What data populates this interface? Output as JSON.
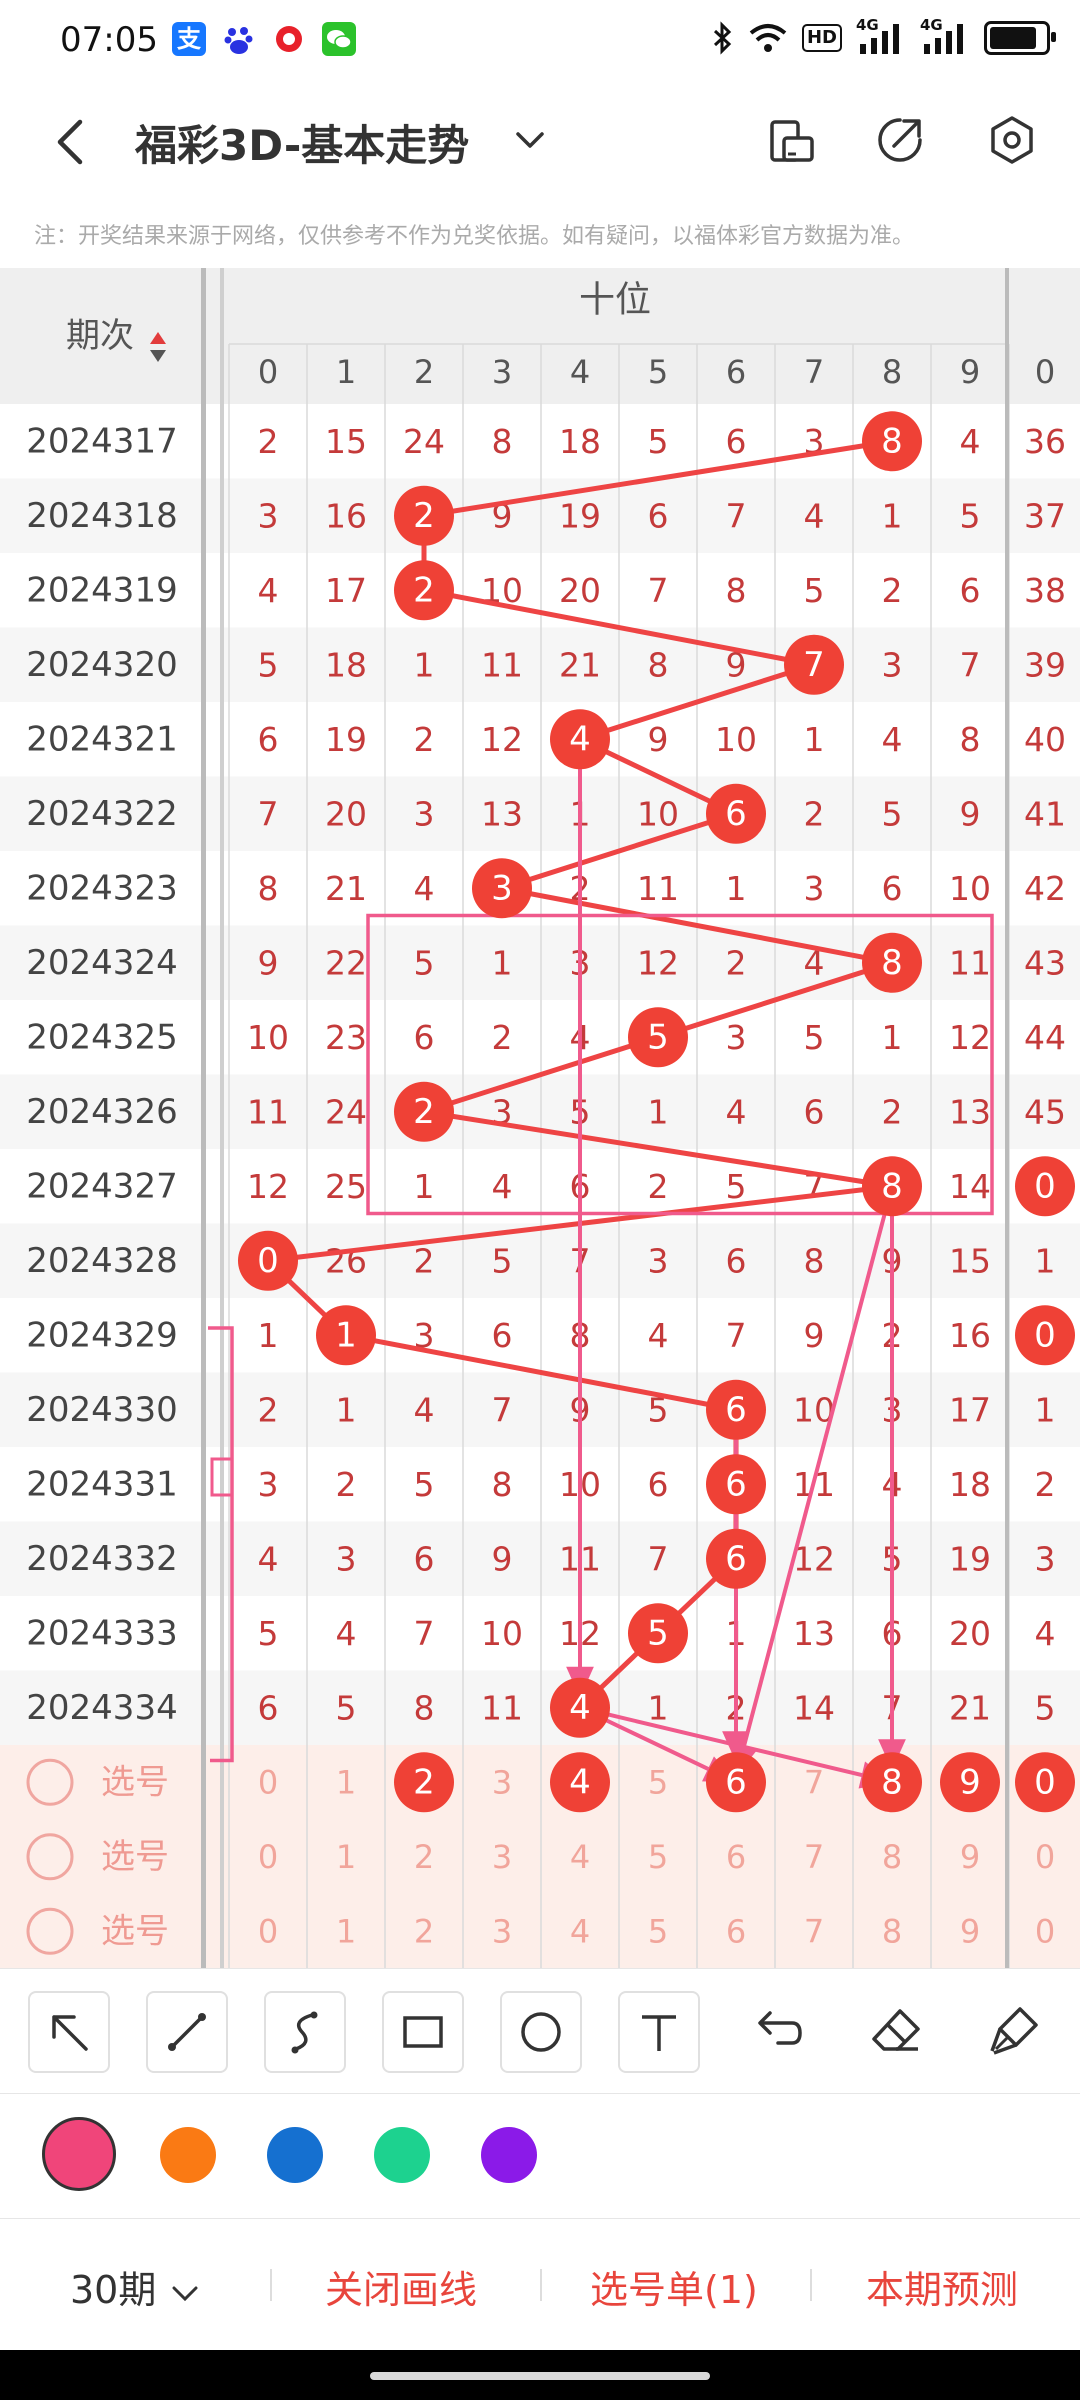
{
  "status_bar": {
    "time": "07:05",
    "app_icons": [
      "alipay-icon",
      "baidu-icon",
      "record-icon",
      "wechat-icon"
    ],
    "right_icons": [
      "bluetooth-icon",
      "wifi-icon",
      "hd-icon",
      "signal-4g-icon",
      "signal-4g-icon",
      "battery-icon"
    ],
    "hd_label": "HD",
    "net_label": "4G"
  },
  "header": {
    "title": "福彩3D-基本走势",
    "icons": [
      "back-icon",
      "chevron-down-icon",
      "device-icon",
      "share-icon",
      "settings-icon"
    ]
  },
  "notice": "注：开奖结果来源于网络，仅供参考不作为兑奖依据。如有疑问，以福体彩官方数据为准。",
  "table": {
    "period_header": "期次",
    "section_header": "十位",
    "digit_columns": [
      "0",
      "1",
      "2",
      "3",
      "4",
      "5",
      "6",
      "7",
      "8",
      "9"
    ],
    "next_section_first": "0",
    "rows": [
      {
        "period": "2024317",
        "cells": [
          2,
          15,
          24,
          8,
          18,
          5,
          6,
          3,
          8,
          4
        ],
        "hit": 8,
        "next": "36"
      },
      {
        "period": "2024318",
        "cells": [
          3,
          16,
          2,
          9,
          19,
          6,
          7,
          4,
          1,
          5
        ],
        "hit": 2,
        "next": "37"
      },
      {
        "period": "2024319",
        "cells": [
          4,
          17,
          2,
          10,
          20,
          7,
          8,
          5,
          2,
          6
        ],
        "hit": 2,
        "next": "38"
      },
      {
        "period": "2024320",
        "cells": [
          5,
          18,
          1,
          11,
          21,
          8,
          9,
          7,
          3,
          7
        ],
        "hit": 7,
        "next": "39"
      },
      {
        "period": "2024321",
        "cells": [
          6,
          19,
          2,
          12,
          4,
          9,
          10,
          1,
          4,
          8
        ],
        "hit": 4,
        "next": "40"
      },
      {
        "period": "2024322",
        "cells": [
          7,
          20,
          3,
          13,
          1,
          10,
          6,
          2,
          5,
          9
        ],
        "hit": 6,
        "next": "41"
      },
      {
        "period": "2024323",
        "cells": [
          8,
          21,
          4,
          3,
          2,
          11,
          1,
          3,
          6,
          10
        ],
        "hit": 3,
        "next": "42"
      },
      {
        "period": "2024324",
        "cells": [
          9,
          22,
          5,
          1,
          3,
          12,
          2,
          4,
          8,
          11
        ],
        "hit": 8,
        "next": "43"
      },
      {
        "period": "2024325",
        "cells": [
          10,
          23,
          6,
          2,
          4,
          5,
          3,
          5,
          1,
          12
        ],
        "hit": 5,
        "next": "44"
      },
      {
        "period": "2024326",
        "cells": [
          11,
          24,
          2,
          3,
          5,
          1,
          4,
          6,
          2,
          13
        ],
        "hit": 2,
        "next": "45"
      },
      {
        "period": "2024327",
        "cells": [
          12,
          25,
          1,
          4,
          6,
          2,
          5,
          7,
          8,
          14
        ],
        "hit": 8,
        "next": "0"
      },
      {
        "period": "2024328",
        "cells": [
          0,
          26,
          2,
          5,
          7,
          3,
          6,
          8,
          9,
          15
        ],
        "hit": 0,
        "next": "1"
      },
      {
        "period": "2024329",
        "cells": [
          1,
          1,
          3,
          6,
          8,
          4,
          7,
          9,
          2,
          16
        ],
        "hit": 1,
        "next": "0"
      },
      {
        "period": "2024330",
        "cells": [
          2,
          1,
          4,
          7,
          9,
          5,
          6,
          10,
          3,
          17
        ],
        "hit": 6,
        "next": "1"
      },
      {
        "period": "2024331",
        "cells": [
          3,
          2,
          5,
          8,
          10,
          6,
          6,
          11,
          4,
          18
        ],
        "hit": 6,
        "next": "2"
      },
      {
        "period": "2024332",
        "cells": [
          4,
          3,
          6,
          9,
          11,
          7,
          6,
          12,
          5,
          19
        ],
        "hit": 6,
        "next": "3"
      },
      {
        "period": "2024333",
        "cells": [
          5,
          4,
          7,
          10,
          12,
          5,
          1,
          13,
          6,
          20
        ],
        "hit": 5,
        "next": "4"
      },
      {
        "period": "2024334",
        "cells": [
          6,
          5,
          8,
          11,
          4,
          1,
          2,
          14,
          7,
          21
        ],
        "hit": 4,
        "next": "5"
      }
    ],
    "pick_rows": [
      {
        "label": "选号",
        "selected": [
          "2",
          "4",
          "6",
          "8",
          "9"
        ],
        "next_selected": true
      },
      {
        "label": "选号",
        "selected": [],
        "next_selected": false
      },
      {
        "label": "选号",
        "selected": [],
        "next_selected": false
      }
    ]
  },
  "drawing_tools": [
    "arrow-tool-icon",
    "line-tool-icon",
    "curve-tool-icon",
    "rectangle-tool-icon",
    "circle-tool-icon",
    "text-tool-icon",
    "undo-icon",
    "eraser-icon",
    "clear-icon"
  ],
  "colors": {
    "palette": [
      "#f0457a",
      "#fa7a14",
      "#1570d0",
      "#1dd28f",
      "#8b1ae8"
    ],
    "hit_ball": "#ef4136",
    "trend_line": "#ee4444",
    "user_drawing": "#f05a8c",
    "cell_text": "#c43a3a",
    "pick_bg": "#fdeee9"
  },
  "bottom_bar": {
    "period_select": "30期",
    "close_drawing": "关闭画线",
    "pick_list": "选号单(1)",
    "predict": "本期预测"
  }
}
